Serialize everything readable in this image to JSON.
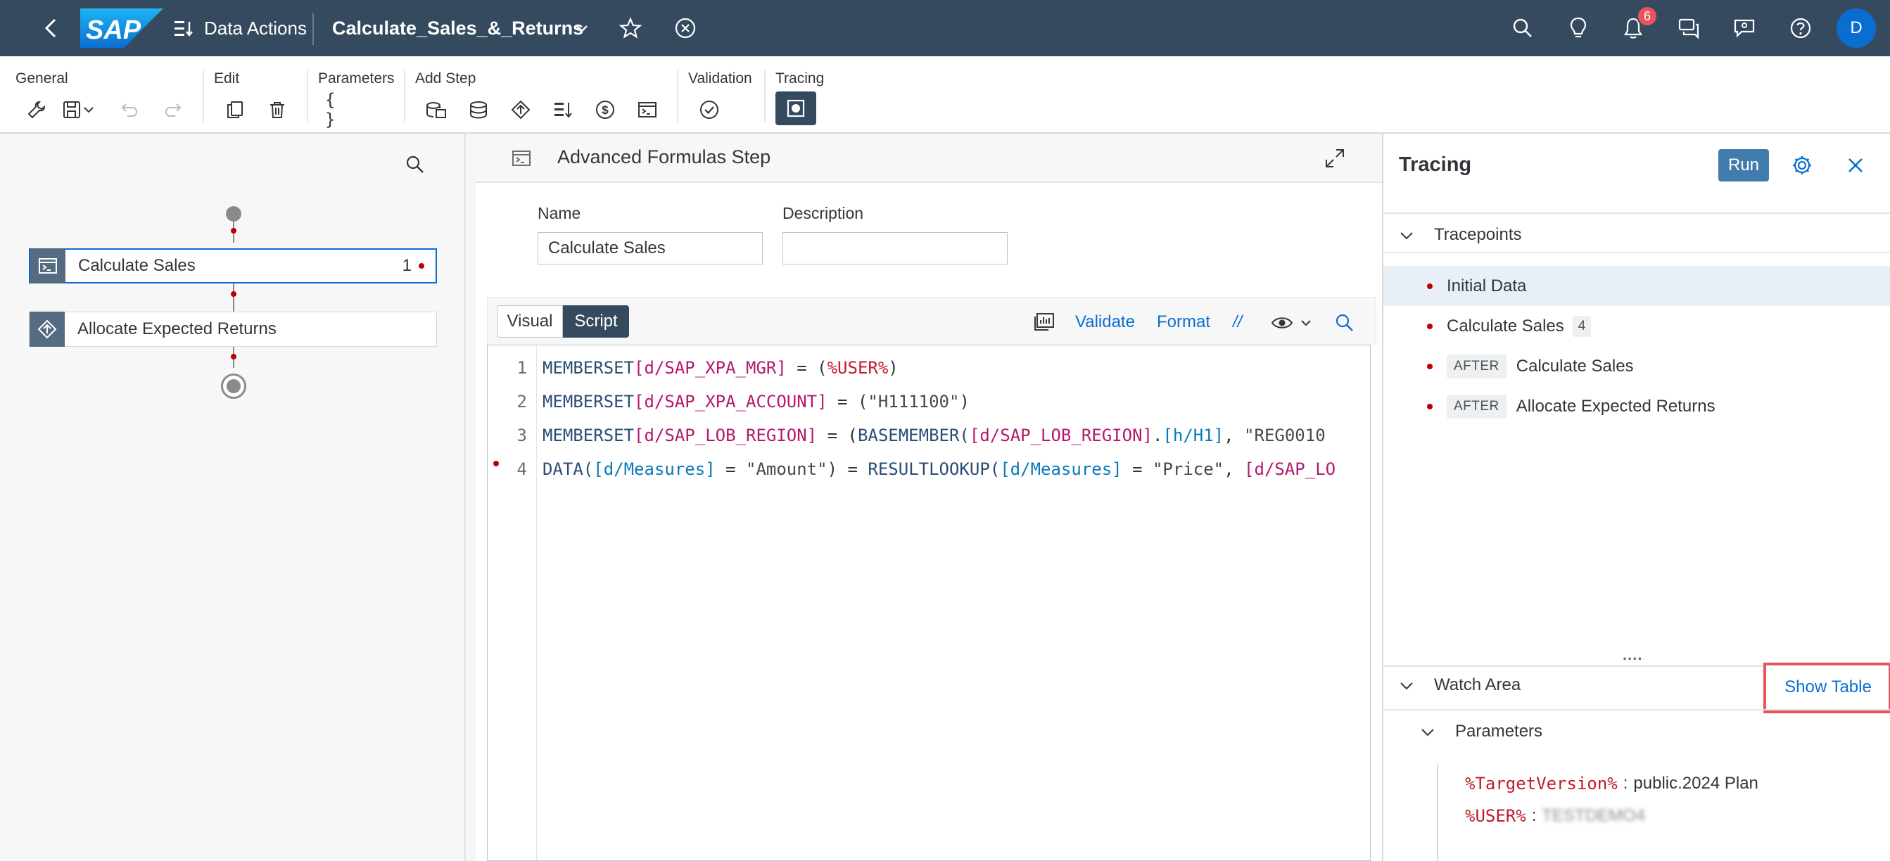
{
  "shell": {
    "brand": "SAP",
    "app_label": "Data Actions",
    "title": "Calculate_Sales_&_Returns",
    "notification_count": "6",
    "avatar_initial": "D"
  },
  "toolbar": {
    "groups": {
      "general": "General",
      "edit": "Edit",
      "parameters": "Parameters",
      "add_step": "Add Step",
      "validation": "Validation",
      "tracing": "Tracing"
    },
    "parameters_glyph": "{ }"
  },
  "flow": {
    "nodes": [
      {
        "label": "Calculate Sales",
        "tracepoint_count": "1"
      },
      {
        "label": "Allocate Expected Returns"
      }
    ]
  },
  "step": {
    "header_title": "Advanced Formulas Step",
    "name_label": "Name",
    "name_value": "Calculate Sales",
    "description_label": "Description",
    "description_value": "",
    "tab_visual": "Visual",
    "tab_script": "Script",
    "validate_label": "Validate",
    "format_label": "Format",
    "comment_label": "//"
  },
  "code": {
    "line_numbers": [
      "1",
      "2",
      "3",
      "4"
    ],
    "l1": {
      "kw": "MEMBERSET",
      "dim": "[d/SAP_XPA_MGR]",
      "eq": " = (",
      "var": "%USER%",
      "close": ")"
    },
    "l2": {
      "kw": "MEMBERSET",
      "dim": "[d/SAP_XPA_ACCOUNT]",
      "eq": " = (",
      "str": "\"H111100\"",
      "close": ")"
    },
    "l3": {
      "kw": "MEMBERSET",
      "dim": "[d/SAP_LOB_REGION]",
      "eq": " = (",
      "fn": "BASEMEMBER(",
      "dim2": "[d/SAP_LOB_REGION]",
      "dot": ".",
      "hier": "[h/H1]",
      "comma": ", ",
      "str": "\"REG0010"
    },
    "l4": {
      "fn": "DATA(",
      "hier": "[d/Measures]",
      "eq": " = ",
      "str": "\"Amount\"",
      "mid": ") = ",
      "fn2": "RESULTLOOKUP(",
      "hier2": "[d/Measures]",
      "eq2": " = ",
      "str2": "\"Price\"",
      "comma": ", ",
      "dim": "[d/SAP_LO"
    }
  },
  "tracing": {
    "title": "Tracing",
    "run_label": "Run",
    "tracepoints_label": "Tracepoints",
    "tracepoints": [
      {
        "label": "Initial Data"
      },
      {
        "label": "Calculate Sales",
        "count": "4"
      },
      {
        "prefix": "AFTER",
        "label": "Calculate Sales"
      },
      {
        "prefix": "AFTER",
        "label": "Allocate Expected Returns"
      }
    ],
    "splitter": "....",
    "watch_area_label": "Watch Area",
    "show_table_label": "Show Table",
    "parameters_label": "Parameters",
    "params": [
      {
        "name": "%TargetVersion%",
        "sep": ":",
        "value": "public.2024 Plan"
      },
      {
        "name": "%USER%",
        "sep": ":",
        "value": "TESTDEMO4"
      }
    ]
  },
  "colors": {
    "shell_bg": "#354a5f",
    "accent": "#0a6ed1",
    "tracepoint_red": "#bb0000",
    "highlight_box": "#e9545b"
  }
}
